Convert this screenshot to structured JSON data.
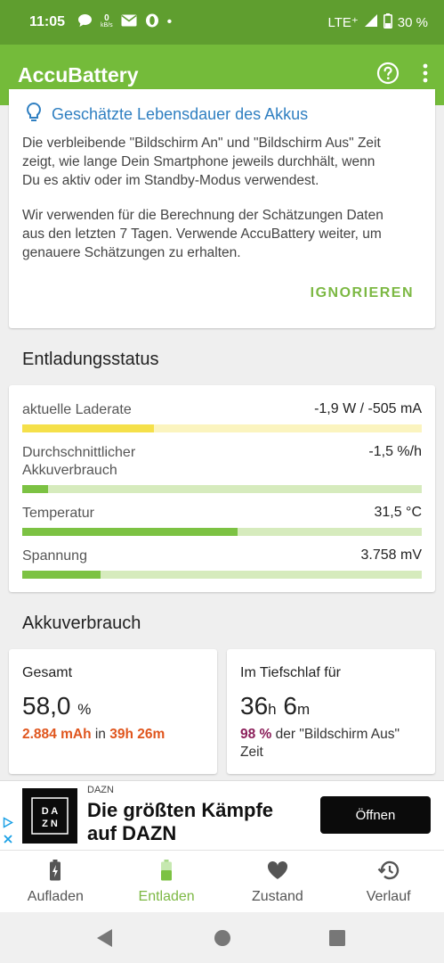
{
  "status_bar": {
    "time": "11:05",
    "net_speed": "0",
    "net_unit": "kB/s",
    "dot": "•",
    "network": "LTE⁺",
    "battery": "30 %",
    "icons": [
      "chat-bubble-icon",
      "email-icon",
      "opera-icon",
      "signal-icon",
      "battery-icon"
    ]
  },
  "app_bar": {
    "title": "AccuBattery",
    "icons": [
      "help-icon",
      "more-vertical-icon"
    ]
  },
  "info_card": {
    "heading": "Geschätzte Lebensdauer des Akkus",
    "para1_line1": "Die verbleibende \"Bildschirm An\" und \"Bildschirm Aus\" Zeit",
    "para1_line2": "zeigt, wie lange Dein Smartphone jeweils durchhält, wenn",
    "para1_line3": "Du es aktiv oder im Standby-Modus verwendest.",
    "para2_line1": "Wir verwenden für die Berechnung der Schätzungen Daten",
    "para2_line2": "aus den letzten 7 Tagen. Verwende AccuBattery weiter, um",
    "para2_line3": "genauere Schätzungen zu erhalten.",
    "button": "IGNORIEREN",
    "icon": "lightbulb-icon"
  },
  "discharge": {
    "title": "Entladungsstatus",
    "metrics": [
      {
        "label": "aktuelle Laderate",
        "value": "-1,9 W / -505 mA",
        "level": 0.33,
        "fill": "#f5e04a",
        "track": "#fbf4bf"
      },
      {
        "label": "Durchschnittlicher",
        "label2": "Akkuverbrauch",
        "value": "-1,5 %/h",
        "level": 0.065,
        "fill": "#7cc243",
        "track": "#d6ebbd"
      },
      {
        "label": "Temperatur",
        "value": "31,5 °C",
        "level": 0.54,
        "fill": "#7cc243",
        "track": "#d6ebbd"
      },
      {
        "label": "Spannung",
        "value": "3.758 mV",
        "level": 0.195,
        "fill": "#7cc243",
        "track": "#d6ebbd"
      }
    ]
  },
  "consumption": {
    "title": "Akkuverbrauch",
    "total": {
      "label": "Gesamt",
      "value": "58,0",
      "unit": "%",
      "mah": "2.884 mAh",
      "in": "in",
      "duration": "39h 26m"
    },
    "deepsleep": {
      "label": "Im Tiefschlaf für",
      "hours": "36",
      "h": "h",
      "minutes": "6",
      "m": "m",
      "percent": "98 %",
      "desc": "der \"Bildschirm Aus\"",
      "desc2": "Zeit"
    }
  },
  "ad": {
    "brand": "DAZN",
    "headline_line1": "Die größten Kämpfe",
    "headline_line2": "auf DAZN",
    "button": "Öffnen",
    "logo_text": "DAZN"
  },
  "bottom_nav": {
    "items": [
      {
        "label": "Aufladen",
        "icon": "battery-charging-icon"
      },
      {
        "label": "Entladen",
        "icon": "battery-discharging-icon"
      },
      {
        "label": "Zustand",
        "icon": "heart-icon"
      },
      {
        "label": "Verlauf",
        "icon": "history-icon"
      }
    ],
    "active": "Entladen"
  },
  "colors": {
    "statusbar": "#5f9e2f",
    "appbar": "#74bb3a",
    "accent_green": "#7cb843",
    "link_blue": "#2f7fc1",
    "orange": "#e0561e",
    "purple": "#8b1f5a"
  }
}
